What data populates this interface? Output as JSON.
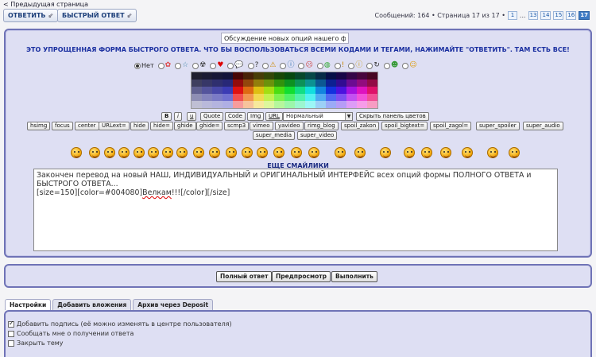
{
  "nav": {
    "prev_page": "< Предыдущая страница"
  },
  "toolbar": {
    "reply": "ОТВЕТИТЬ",
    "quick_reply": "БЫСТРЫЙ ОТВЕТ"
  },
  "pager": {
    "summary": "Сообщений: 164 • Страница 17 из 17 •",
    "pages": [
      "1",
      "...",
      "13",
      "14",
      "15",
      "16",
      "17"
    ],
    "current": "17"
  },
  "form": {
    "subject": "Обсуждение новых опций нашего форума",
    "notice": "ЭТО УПРОЩЕННАЯ ФОРМА БЫСТРОГО ОТВЕТА. ЧТО БЫ ВОСПОЛЬЗОВАТЬСЯ ВСЕМИ КОДАМИ И ТЕГАМИ, НАЖИМАЙТЕ \"ОТВЕТИТЬ\". ТАМ ЕСТЬ ВСЕ!",
    "icon_none_label": "Нет",
    "font_size_selected": "Нормальный",
    "hide_colors": "Скрыть панель цветов",
    "more_smilies": "ЕЩЕ СМАЙЛИКИ",
    "message_line1": "Закончен перевод на новый НАШ, ИНДИВИДУАЛЬНЫЙ и ОРИГИНАЛЬНЫЙ ИНТЕРФЕЙС всех опций формы ПОЛНОГО ОТВЕТА и БЫСТРОГО ОТВЕТА...",
    "message_line2_pre": "[size=150][color=#004080]",
    "message_line2_word": "Велкам",
    "message_line2_post": "!!![/color][/size]"
  },
  "bbcode_row1": [
    "B",
    "i",
    "u",
    "Quote",
    "Code",
    "Img",
    "URL"
  ],
  "bbcode_row2": [
    "hsimg",
    "focus",
    "center",
    "URLext=",
    "hide",
    "hide=",
    "ghide",
    "ghide=",
    "scmp3",
    "vimeo",
    "yavideo",
    "rimg_blog",
    "spoil_zakon",
    "spoil_bigtext=",
    "spoil_zagol=",
    "super_spoiler",
    "super_audio"
  ],
  "bbcode_row3": [
    "super_media",
    "super_video"
  ],
  "actions": {
    "full": "Полный ответ",
    "preview": "Предпросмотр",
    "submit": "Выполнить"
  },
  "tabs": [
    "Настройки",
    "Добавить вложения",
    "Архив через Deposit"
  ],
  "options": [
    {
      "label": "Добавить подпись (её можно изменять в центре пользователя)",
      "checked": true
    },
    {
      "label": "Сообщать мне о получении ответа",
      "checked": false
    },
    {
      "label": "Закрыть тему",
      "checked": false
    }
  ],
  "colors": {
    "panel_bg": "#dedff3",
    "panel_border": "#6f73b6",
    "notice_text": "#1a2fa0"
  }
}
